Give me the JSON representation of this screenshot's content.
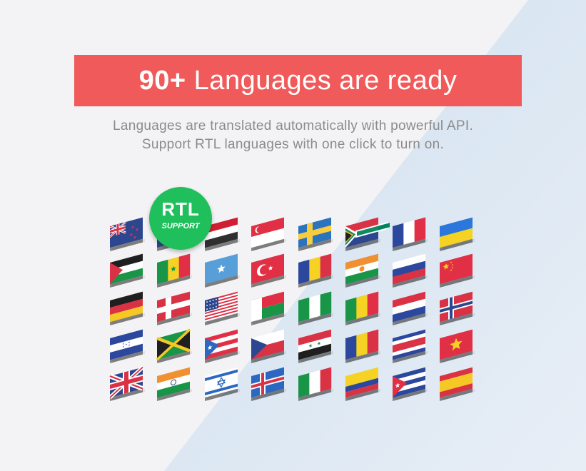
{
  "banner": {
    "number": "90+",
    "text": "Languages are ready"
  },
  "subtitle": {
    "line1": "Languages are translated automatically with powerful API.",
    "line2": "Support RTL languages with one click to turn on."
  },
  "badge": {
    "title": "RTL",
    "subtitle": "SUPPORT"
  },
  "colors": {
    "banner": "#f05a5a",
    "badge": "#1fbf5c",
    "text": "#8b8b8b"
  },
  "flags": [
    [
      "new-zealand",
      "hidden",
      "egypt",
      "singapore",
      "sweden",
      "south-africa",
      "france",
      "ukraine"
    ],
    [
      "palestine",
      "senegal",
      "somalia",
      "turkey",
      "romania",
      "niger",
      "russia",
      "china"
    ],
    [
      "germany",
      "denmark",
      "usa",
      "madagascar",
      "nigeria",
      "mali",
      "netherlands",
      "norway"
    ],
    [
      "honduras",
      "jamaica",
      "puerto-rico",
      "czech-republic",
      "syria",
      "chad",
      "costa-rica",
      "vietnam"
    ],
    [
      "united-kingdom",
      "india",
      "israel",
      "iceland",
      "italy",
      "colombia",
      "cuba",
      "spain"
    ]
  ]
}
